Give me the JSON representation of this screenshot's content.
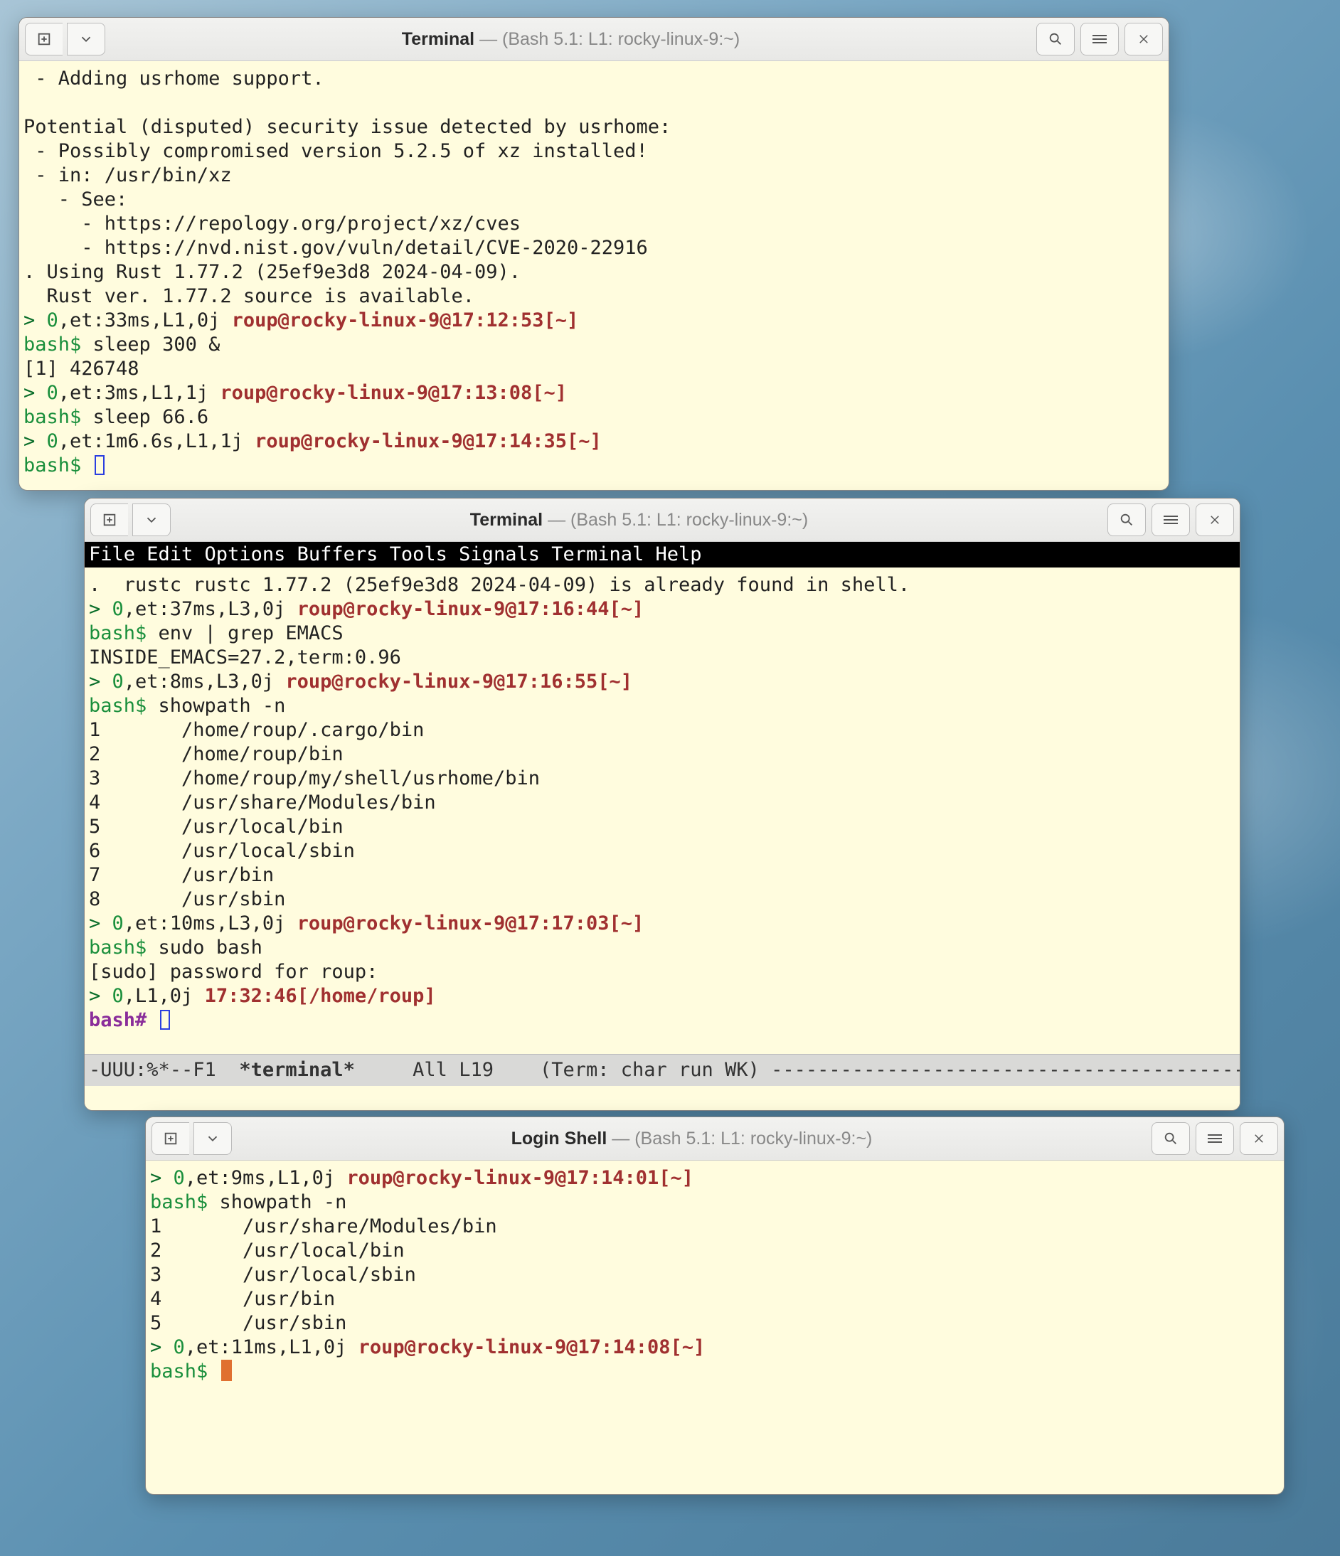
{
  "win1": {
    "title_app": "Terminal",
    "title_sep": " — ",
    "title_detail": "(Bash 5.1: L1: rocky-linux-9:~)",
    "l00": " - Adding usrhome support.",
    "l01": "",
    "l02": "Potential (disputed) security issue detected by usrhome:",
    "l03": " - Possibly compromised version 5.2.5 of xz installed!",
    "l04": " - in: /usr/bin/xz",
    "l05": "   - See:",
    "l06": "     - https://repology.org/project/xz/cves",
    "l07": "     - https://nvd.nist.gov/vuln/detail/CVE-2020-22916",
    "l08": ". Using Rust 1.77.2 (25ef9e3d8 2024-04-09).",
    "l09": "  Rust ver. 1.77.2 source is available.",
    "p1a": "> ",
    "p1b": "0",
    "p1c": ",et:33ms,L1,0j ",
    "p1d": "roup@rocky-linux-9@17:12:53[~]",
    "bash": "bash$",
    "cmd1": " sleep 300 &",
    "out1": "[1] 426748",
    "p2a": "> ",
    "p2b": "0",
    "p2c": ",et:3ms,L1,1j ",
    "p2d": "roup@rocky-linux-9@17:13:08[~]",
    "cmd2": " sleep 66.6",
    "p3a": "> ",
    "p3b": "0",
    "p3c": ",et:1m6.6s,L1,1j ",
    "p3d": "roup@rocky-linux-9@17:14:35[~]"
  },
  "win2": {
    "title_app": "Terminal",
    "title_sep": " — ",
    "title_detail": "(Bash 5.1: L1: rocky-linux-9:~)",
    "menu": "File Edit Options Buffers Tools Signals Terminal Help",
    "l00": ".  rustc rustc 1.77.2 (25ef9e3d8 2024-04-09) is already found in shell.",
    "p1a": "> ",
    "p1b": "0",
    "p1c": ",et:37ms,L3,0j ",
    "p1d": "roup@rocky-linux-9@17:16:44[~]",
    "bash": "bash$",
    "cmd1": " env | grep EMACS",
    "out1": "INSIDE_EMACS=27.2,term:0.96",
    "p2a": "> ",
    "p2b": "0",
    "p2c": ",et:8ms,L3,0j ",
    "p2d": "roup@rocky-linux-9@17:16:55[~]",
    "cmd2": " showpath -n",
    "sp1": "1       /home/roup/.cargo/bin",
    "sp2": "2       /home/roup/bin",
    "sp3": "3       /home/roup/my/shell/usrhome/bin",
    "sp4": "4       /usr/share/Modules/bin",
    "sp5": "5       /usr/local/bin",
    "sp6": "6       /usr/local/sbin",
    "sp7": "7       /usr/bin",
    "sp8": "8       /usr/sbin",
    "p3a": "> ",
    "p3b": "0",
    "p3c": ",et:10ms,L3,0j ",
    "p3d": "roup@rocky-linux-9@17:17:03[~]",
    "cmd3": " sudo bash",
    "sudo": "[sudo] password for roup:",
    "p4a": "> ",
    "p4b": "0",
    "p4c": ",L1,0j ",
    "p4d": "17:32:46[/home/roup]",
    "bashroot": "bash#",
    "mode_left": "-UUU:%*--F1  ",
    "mode_buf": "*terminal*",
    "mode_mid": "     All L19    (Term: char run WK) ",
    "mode_dashes": "----------------------------------------------"
  },
  "win3": {
    "title_app": "Login Shell",
    "title_sep": " — ",
    "title_detail": "(Bash 5.1: L1: rocky-linux-9:~)",
    "p1a": "> ",
    "p1b": "0",
    "p1c": ",et:9ms,L1,0j ",
    "p1d": "roup@rocky-linux-9@17:14:01[~]",
    "bash": "bash$",
    "cmd1": " showpath -n",
    "sp1": "1       /usr/share/Modules/bin",
    "sp2": "2       /usr/local/bin",
    "sp3": "3       /usr/local/sbin",
    "sp4": "4       /usr/bin",
    "sp5": "5       /usr/sbin",
    "p2a": "> ",
    "p2b": "0",
    "p2c": ",et:11ms,L1,0j ",
    "p2d": "roup@rocky-linux-9@17:14:08[~]"
  }
}
